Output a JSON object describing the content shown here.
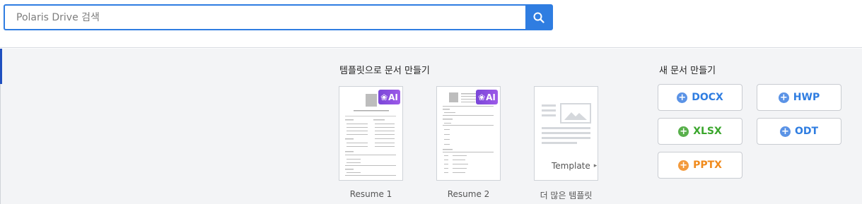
{
  "search": {
    "placeholder": "Polaris Drive 검색"
  },
  "templates_section": {
    "title": "템플릿으로 문서 만들기",
    "items": [
      {
        "label": "Resume 1",
        "badge": "AI"
      },
      {
        "label": "Resume 2",
        "badge": "AI"
      }
    ],
    "more": {
      "card_text": "Template",
      "label": "더 많은 템플릿"
    }
  },
  "new_section": {
    "title": "새 문서 만들기",
    "buttons": [
      {
        "label": "DOCX",
        "color": "#2f7de1",
        "icon_color": "#5b93e6"
      },
      {
        "label": "HWP",
        "color": "#2f7de1",
        "icon_color": "#5b93e6"
      },
      {
        "label": "XLSX",
        "color": "#3aa62c",
        "icon_color": "#59b04c"
      },
      {
        "label": "ODT",
        "color": "#2f7de1",
        "icon_color": "#5b93e6"
      },
      {
        "label": "PPTX",
        "color": "#f08a1c",
        "icon_color": "#f39a3c"
      }
    ]
  }
}
